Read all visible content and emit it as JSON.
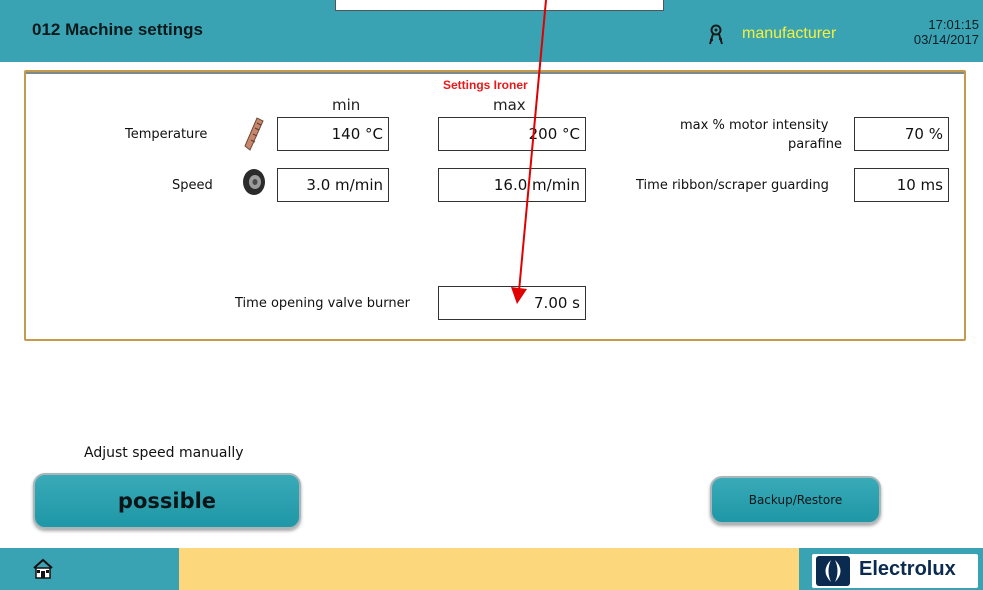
{
  "header": {
    "title": "012 Machine settings",
    "user": "manufacturer",
    "time": "17:01:15",
    "date": "03/14/2017",
    "user_icon": "keys-icon"
  },
  "panel": {
    "title": "Settings Ironer",
    "col_min": "min",
    "col_max": "max",
    "temperature": {
      "label": "Temperature",
      "min": "140 °C",
      "max": "200 °C",
      "icon": "thermometer-icon"
    },
    "speed": {
      "label": "Speed",
      "min": "3.0 m/min",
      "max": "16.0 m/min",
      "icon": "wheel-icon"
    },
    "valve": {
      "label": "Time opening valve burner",
      "value": "7.00 s"
    },
    "motor": {
      "label_line1": "max % motor intensity",
      "label_line2": "parafine",
      "value": "70 %"
    },
    "ribbon": {
      "label": "Time ribbon/scraper guarding",
      "value": "10 ms"
    }
  },
  "controls": {
    "adjust_label": "Adjust speed manually",
    "possible_button": "possible",
    "backup_button": "Backup/Restore"
  },
  "footer": {
    "message": "",
    "brand": "Electrolux",
    "home_icon": "home-icon"
  },
  "colors": {
    "teal": "#3aa3b3",
    "user": "#f6f03c",
    "title_red": "#e61a1a",
    "panel_border": "#c49a4c",
    "message_bar": "#fdd77c",
    "brand_navy": "#0b2a4f"
  }
}
